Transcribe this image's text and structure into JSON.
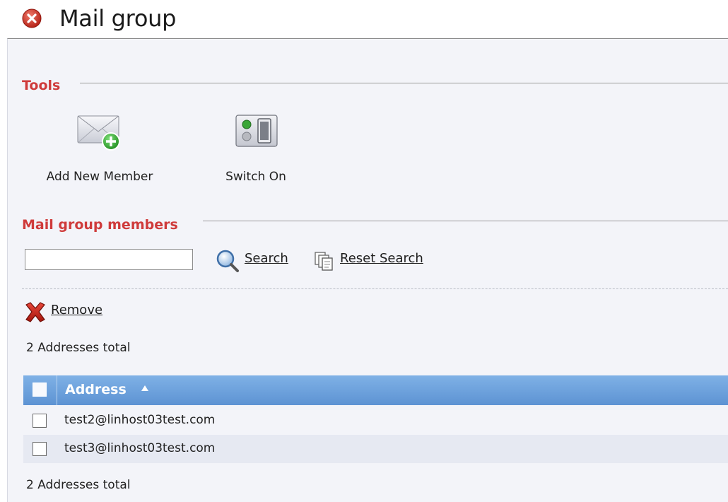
{
  "window": {
    "title": "Mail group",
    "close_icon": "close-circle-icon"
  },
  "tools": {
    "section_title": "Tools",
    "items": [
      {
        "label": "Add New Member",
        "icon": "add-mail-icon"
      },
      {
        "label": "Switch On",
        "icon": "switch-icon"
      }
    ]
  },
  "members": {
    "section_title": "Mail group members",
    "search": {
      "value": "",
      "placeholder": "",
      "search_label": "Search",
      "reset_label": "Reset Search"
    },
    "remove_label": "Remove",
    "total_top": "2 Addresses total",
    "total_bottom": "2 Addresses total",
    "table": {
      "columns": [
        "Address"
      ],
      "sort": "ascending",
      "rows": [
        {
          "address": "test2@linhost03test.com"
        },
        {
          "address": "test3@linhost03test.com"
        }
      ]
    }
  },
  "colors": {
    "section_title": "#cf3b3b",
    "header_gradient_top": "#7fb1e6",
    "header_gradient_bottom": "#5d93d3",
    "row_alt": "#e6e9f2",
    "background": "#f3f4f9"
  }
}
